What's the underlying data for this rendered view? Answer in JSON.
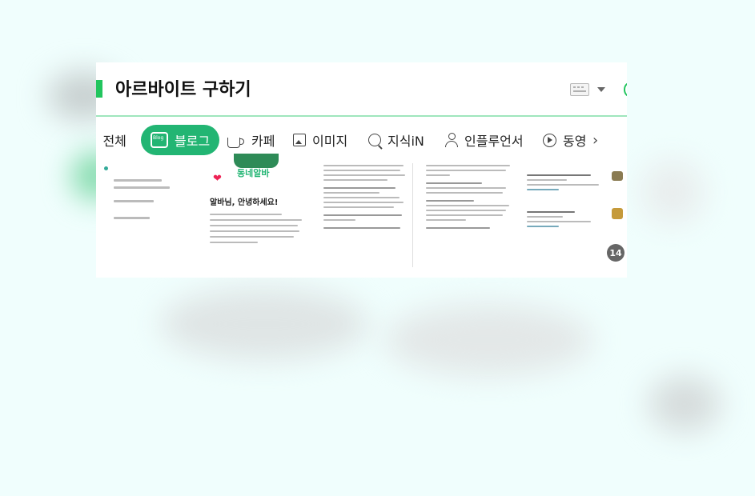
{
  "header": {
    "title": "아르바이트 구하기",
    "accent_color": "#22c55e",
    "keyboard_icon": "keyboard-icon",
    "dropdown_icon": "caret-down-icon"
  },
  "tabs": [
    {
      "label": "전체",
      "icon": "list-icon",
      "active": false
    },
    {
      "label": "블로그",
      "icon": "blog-icon",
      "active": true
    },
    {
      "label": "카페",
      "icon": "cup-icon",
      "active": false
    },
    {
      "label": "이미지",
      "icon": "image-icon",
      "active": false
    },
    {
      "label": "지식iN",
      "icon": "question-icon",
      "active": false
    },
    {
      "label": "인플루언서",
      "icon": "person-icon",
      "active": false
    },
    {
      "label": "동영",
      "icon": "play-icon",
      "active": false
    }
  ],
  "more_icon": "chevron-right-icon",
  "cards": {
    "welcome": {
      "logo_text": "동네알바",
      "heading": "알바님, 안녕하세요!"
    },
    "image_count": "14"
  }
}
